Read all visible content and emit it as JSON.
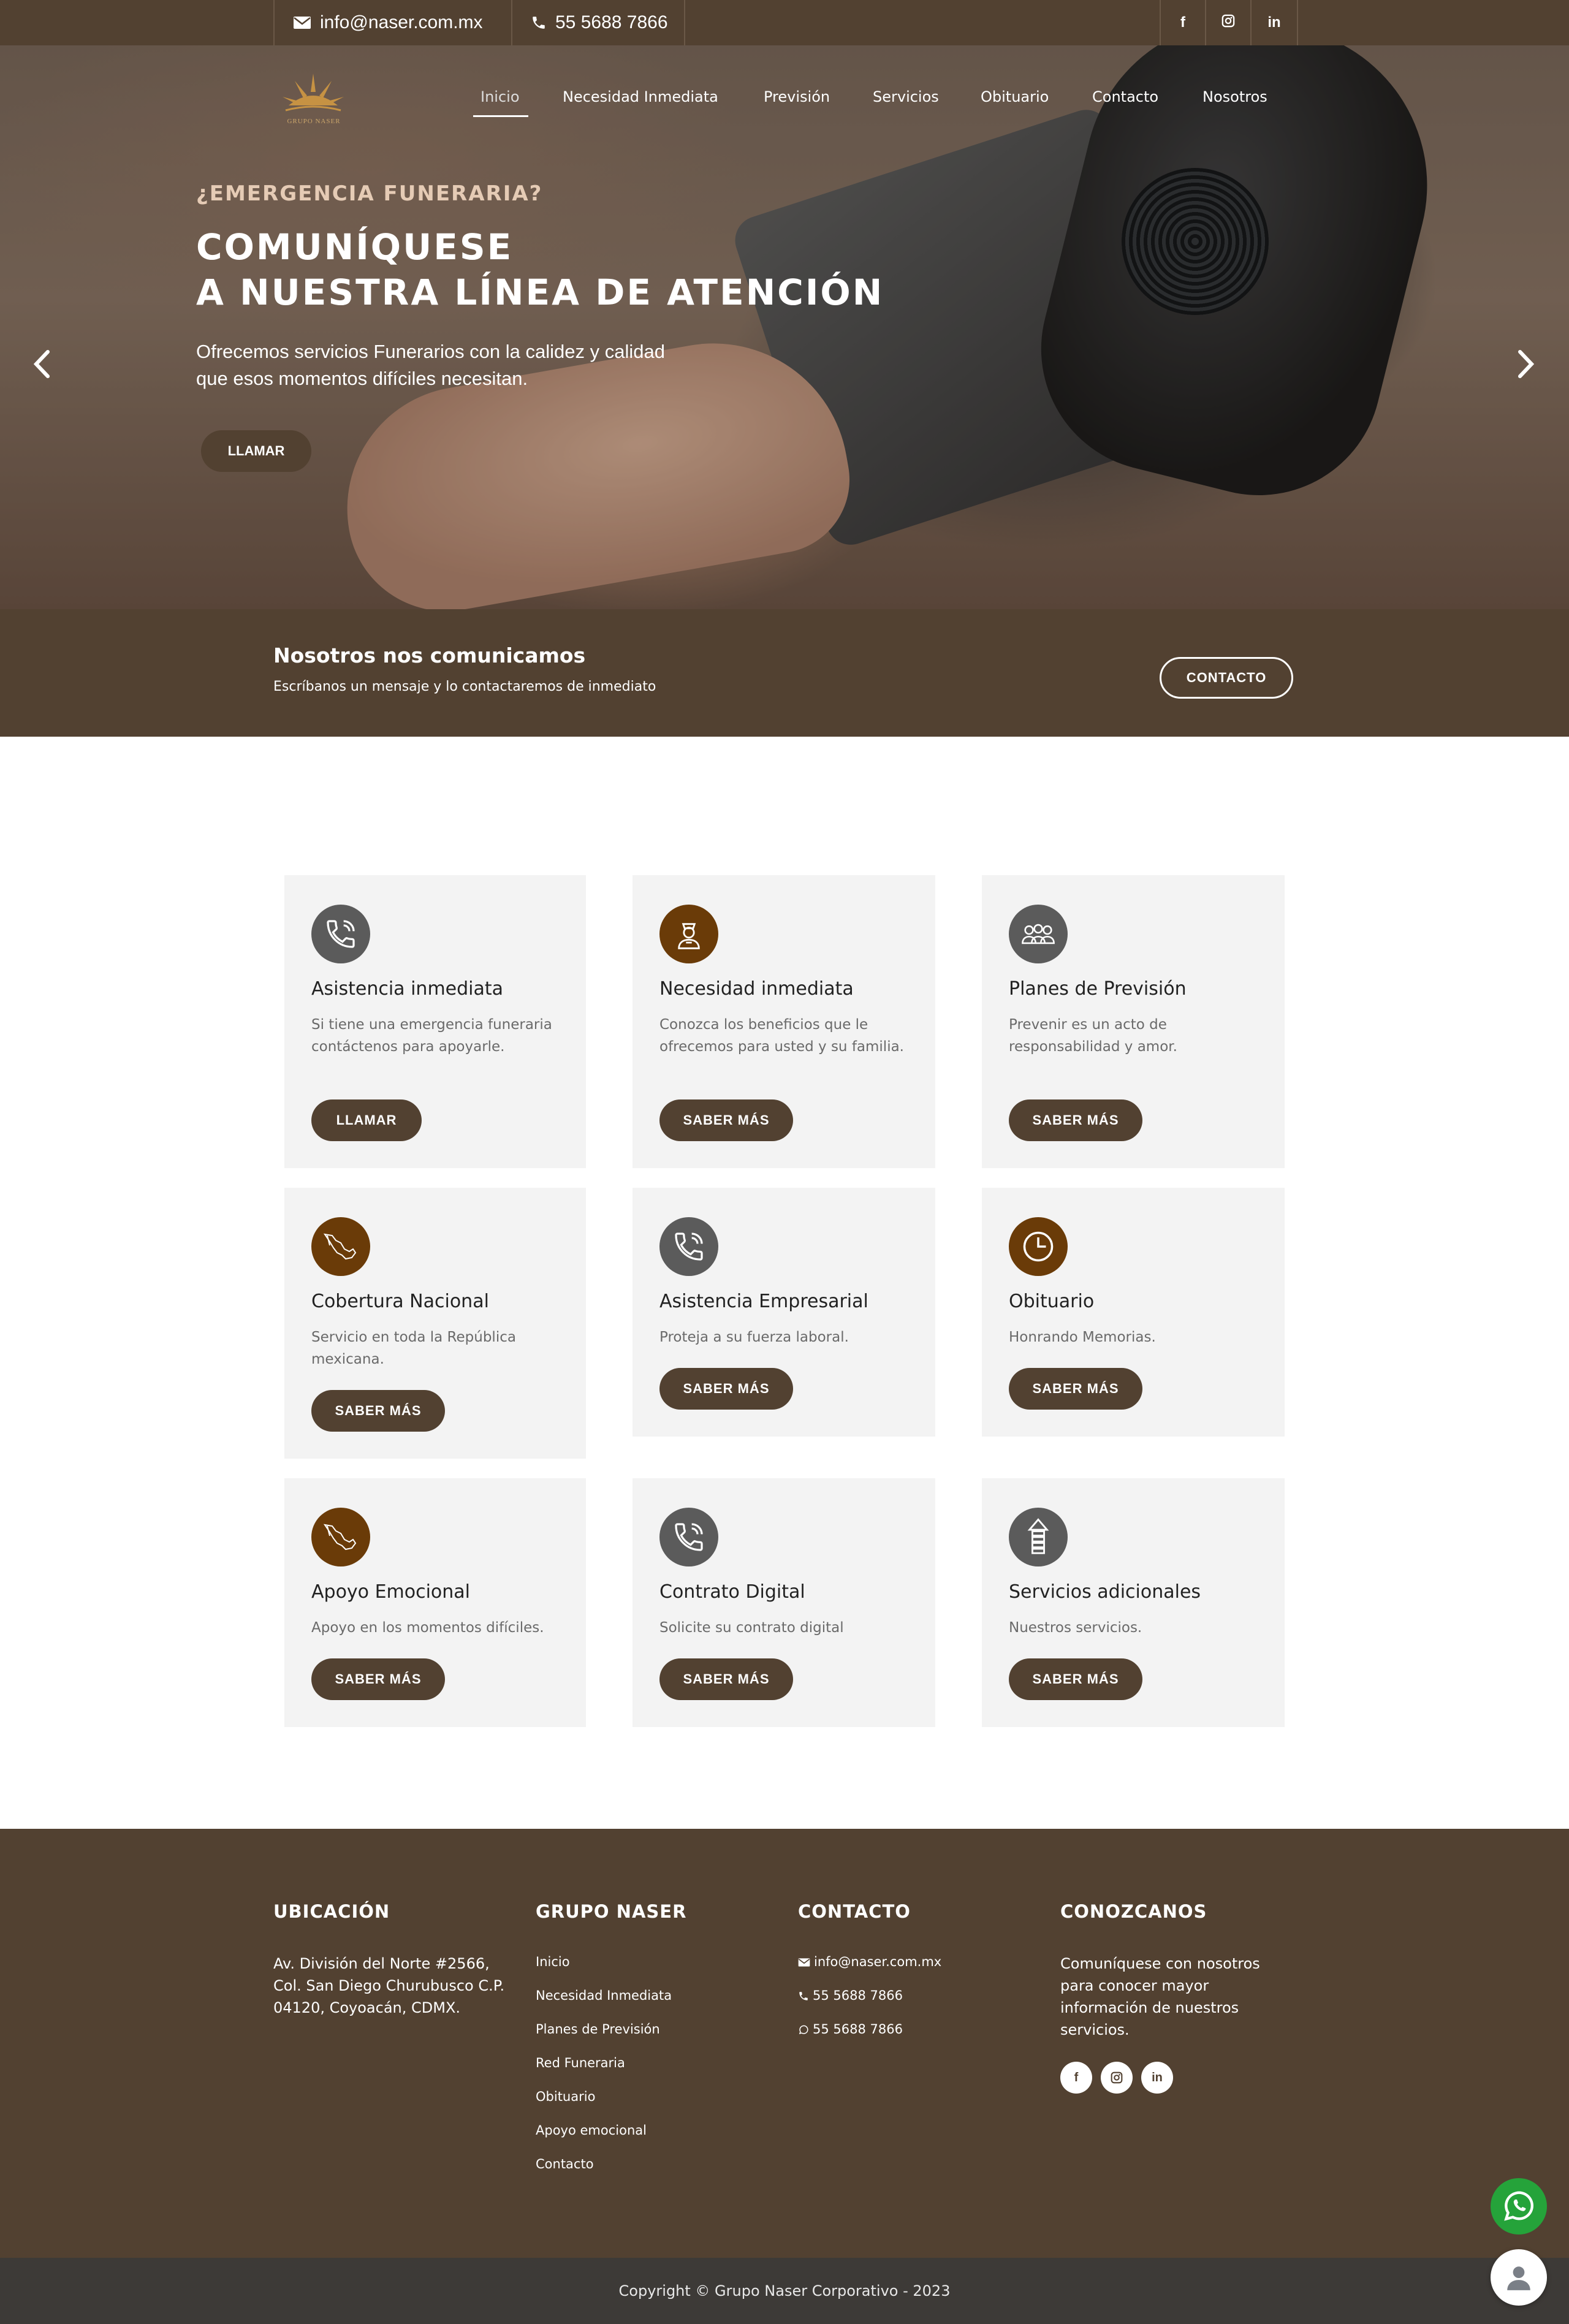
{
  "topbar": {
    "email": "info@naser.com.mx",
    "phone": "55 5688 7866",
    "social": [
      {
        "icon": "facebook-icon",
        "label": "f"
      },
      {
        "icon": "instagram-icon",
        "label": ""
      },
      {
        "icon": "linkedin-icon",
        "label": "in"
      }
    ]
  },
  "logo": {
    "text": "GRUPO NASER"
  },
  "nav": {
    "items": [
      "Inicio",
      "Necesidad Inmediata",
      "Previsión",
      "Servicios",
      "Obituario",
      "Contacto",
      "Nosotros"
    ],
    "active": "Inicio"
  },
  "hero": {
    "kicker": "¿EMERGENCIA FUNERARIA?",
    "title_line1": "COMUNÍQUESE",
    "title_line2": "A NUESTRA LÍNEA DE ATENCIÓN",
    "desc_line1": "Ofrecemos servicios Funerarios con la calidez y calidad",
    "desc_line2": "que esos momentos difíciles necesitan.",
    "button": "LLAMAR"
  },
  "cta": {
    "title": "Nosotros nos comunicamos",
    "subtitle": "Escríbanos un mensaje y lo contactaremos de inmediato",
    "button": "CONTACTO"
  },
  "cards": [
    {
      "icon": "phone-ring-icon",
      "title": "Asistencia inmediata",
      "desc": "Si tiene una emergencia funeraria contáctenos para apoyarle.",
      "button": "LLAMAR"
    },
    {
      "icon": "nurse-icon",
      "title": "Necesidad inmediata",
      "desc": "Conozca los beneficios que le ofrecemos para usted y su familia.",
      "button": "SABER MÁS"
    },
    {
      "icon": "group-icon",
      "title": "Planes de Previsión",
      "desc": "Prevenir es un acto de responsabilidad y amor.",
      "button": "SABER MÁS"
    },
    {
      "icon": "mexico-map-icon",
      "title": "Cobertura Nacional",
      "desc": "Servicio en toda la República mexicana.",
      "button": "SABER MÁS"
    },
    {
      "icon": "phone-ring-icon",
      "title": "Asistencia Empresarial",
      "desc": "Proteja a su fuerza laboral.",
      "button": "SABER MÁS"
    },
    {
      "icon": "clock-icon",
      "title": "Obituario",
      "desc": "Honrando Memorias.",
      "button": "SABER MÁS"
    },
    {
      "icon": "mexico-map-icon",
      "title": "Apoyo Emocional",
      "desc": "Apoyo en los momentos difíciles.",
      "button": "SABER MÁS"
    },
    {
      "icon": "phone-ring-icon",
      "title": "Contrato Digital",
      "desc": "Solicite su contrato digital",
      "button": "SABER MÁS"
    },
    {
      "icon": "arrow-up-icon",
      "title": "Servicios adicionales",
      "desc": "Nuestros servicios.",
      "button": "SABER MÁS"
    }
  ],
  "footer": {
    "location": {
      "heading": "UBICACIÓN",
      "lines": [
        "Av. División del Norte #2566,",
        "Col. San Diego Churubusco C.P.",
        "04120, Coyoacán, CDMX."
      ]
    },
    "group": {
      "heading": "GRUPO NASER",
      "links": [
        "Inicio",
        "Necesidad Inmediata",
        "Planes de Previsión",
        "Red Funeraria",
        "Obituario",
        "Apoyo emocional",
        "Contacto"
      ]
    },
    "contact": {
      "heading": "CONTACTO",
      "email": "info@naser.com.mx",
      "phone": "55 5688 7866",
      "whatsapp": "55 5688 7866"
    },
    "about": {
      "heading": "CONOZCANOS",
      "lines": [
        "Comuníquese con nosotros",
        "para conocer mayor",
        "información de nuestros",
        "servicios."
      ]
    }
  },
  "copyright": "Copyright © Grupo Naser Corporativo - 2023",
  "colors": {
    "brand_brown": "#524131",
    "whatsapp_green": "#25a33a",
    "icon_brown": "#6a3b08",
    "icon_gray": "#5b5b5b"
  }
}
